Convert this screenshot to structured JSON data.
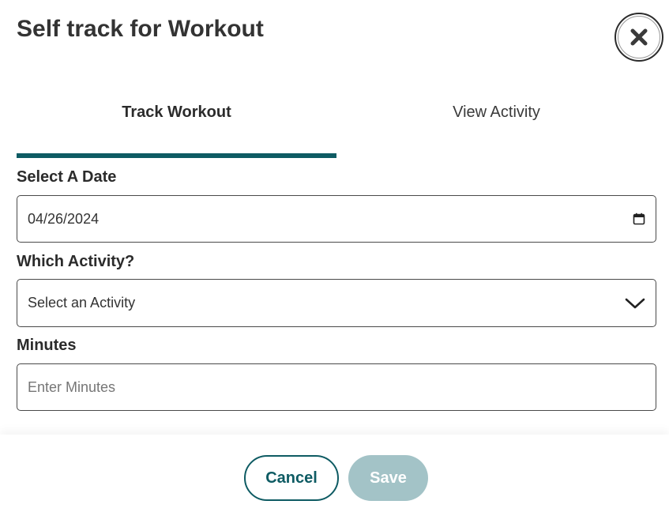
{
  "dialog": {
    "title": "Self track for Workout",
    "close_icon": "close-icon"
  },
  "tabs": [
    {
      "label": "Track Workout",
      "active": true
    },
    {
      "label": "View Activity",
      "active": false
    }
  ],
  "colors": {
    "accent": "#0e5b63",
    "save_disabled": "#a3c3c7"
  },
  "form": {
    "date": {
      "label": "Select A Date",
      "value": "04/26/2024",
      "icon": "calendar-icon"
    },
    "activity": {
      "label": "Which Activity?",
      "selected": "Select an Activity",
      "icon": "chevron-down-icon"
    },
    "minutes": {
      "label": "Minutes",
      "placeholder": "Enter Minutes"
    }
  },
  "footer": {
    "cancel_label": "Cancel",
    "save_label": "Save"
  }
}
